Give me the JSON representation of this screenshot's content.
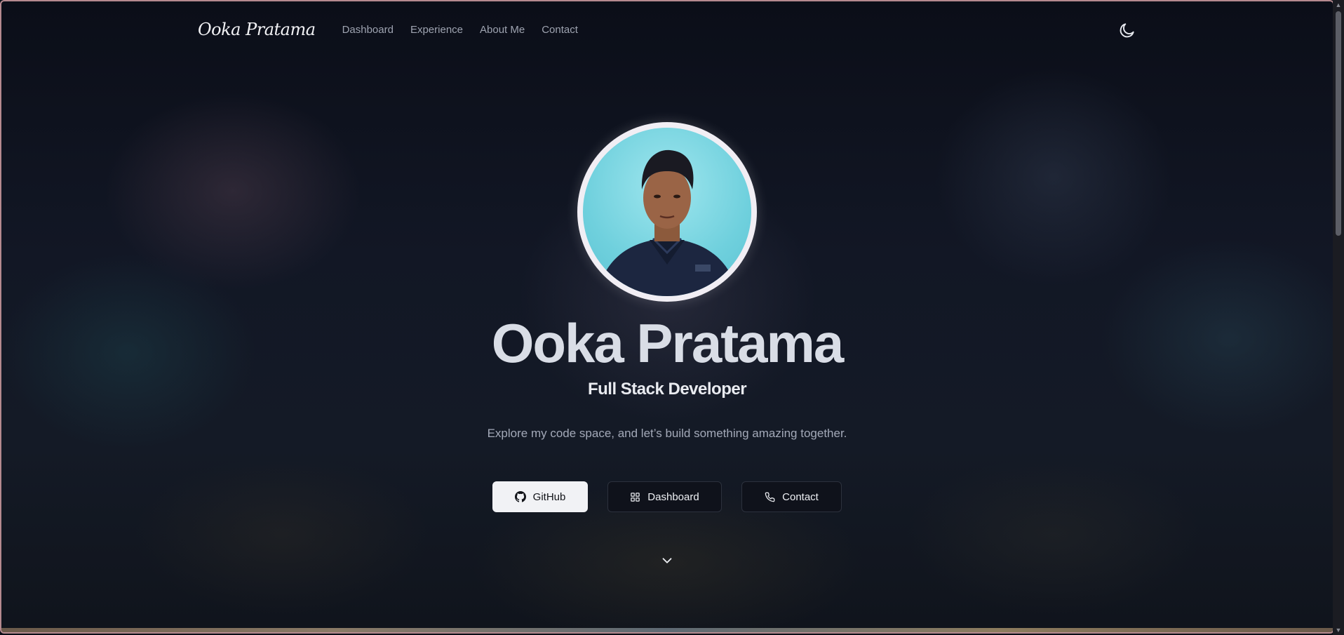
{
  "nav": {
    "logo": "Ooka Pratama",
    "links": [
      "Dashboard",
      "Experience",
      "About Me",
      "Contact"
    ]
  },
  "hero": {
    "name": "Ooka Pratama",
    "role": "Full Stack Developer",
    "tagline": "Explore my code space, and let’s build something amazing together.",
    "buttons": {
      "github": "GitHub",
      "dashboard": "Dashboard",
      "contact": "Contact"
    }
  },
  "icons": {
    "theme_toggle": "moon-icon",
    "github": "github-icon",
    "dashboard": "grid-icon",
    "contact": "phone-icon",
    "scroll": "chevron-down-icon"
  },
  "colors": {
    "background": "#0b0e17",
    "primary_button_bg": "#f1f2f5",
    "secondary_button_bg": "#0f121b",
    "text_primary": "#e9ebf0",
    "text_muted": "#a3a9b8"
  }
}
